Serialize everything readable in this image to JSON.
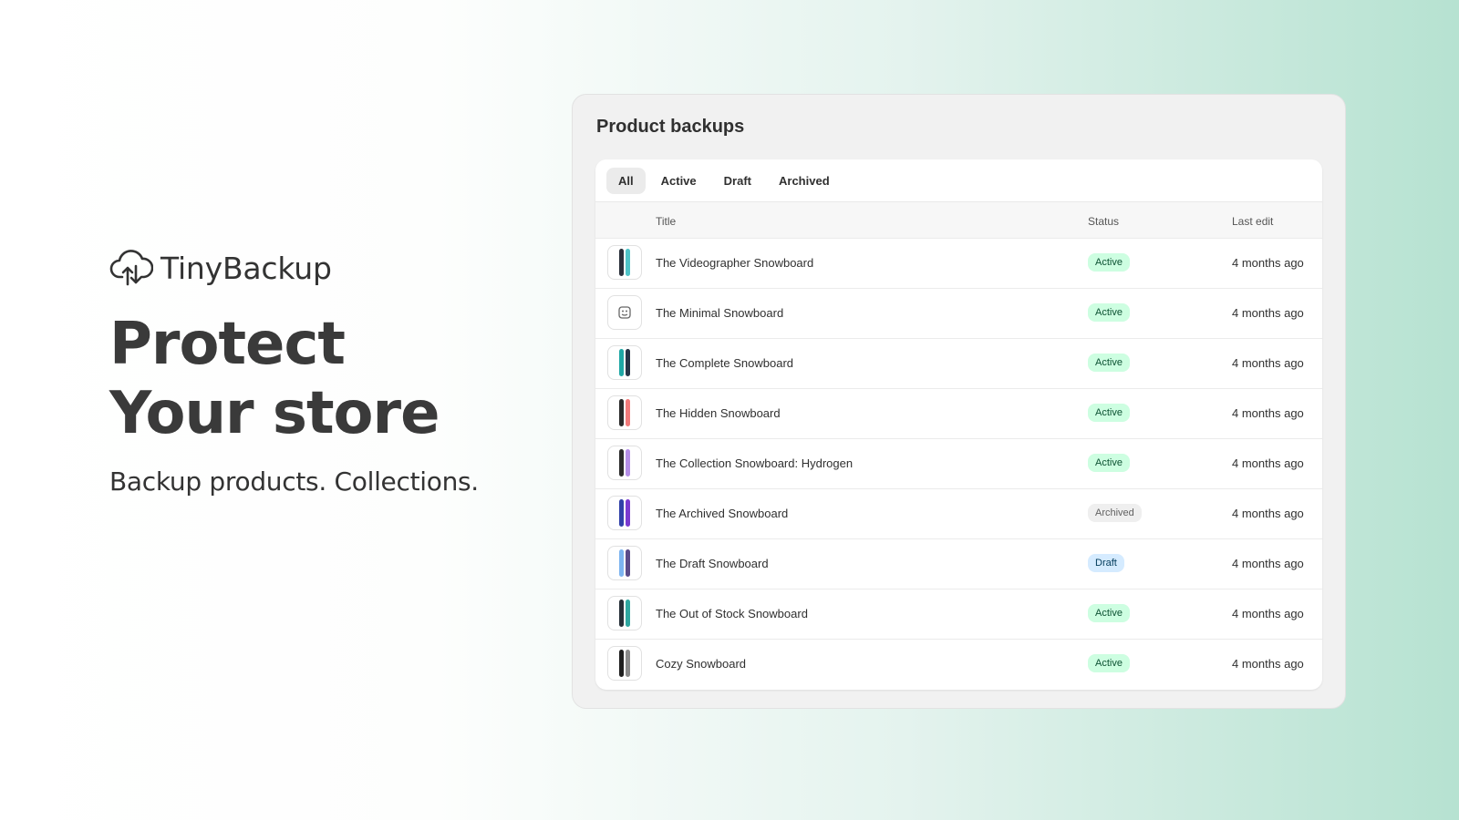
{
  "brand": {
    "name": "TinyBackup",
    "logo_icon": "cloud-upload-download-icon"
  },
  "hero": {
    "headline_line1": "Protect",
    "headline_line2": "Your store",
    "subline": "Backup products. Collections."
  },
  "panel": {
    "title": "Product backups",
    "tabs": [
      {
        "label": "All",
        "selected": true
      },
      {
        "label": "Active",
        "selected": false
      },
      {
        "label": "Draft",
        "selected": false
      },
      {
        "label": "Archived",
        "selected": false
      }
    ],
    "columns": {
      "title": "Title",
      "status": "Status",
      "last_edit": "Last edit"
    },
    "rows": [
      {
        "title": "The Videographer Snowboard",
        "status": "Active",
        "last_edit": "4 months ago",
        "thumb_colors": [
          "#2a2f3a",
          "#4fc3c7"
        ]
      },
      {
        "title": "The Minimal Snowboard",
        "status": "Active",
        "last_edit": "4 months ago",
        "thumb_icon": "image-placeholder-icon"
      },
      {
        "title": "The Complete Snowboard",
        "status": "Active",
        "last_edit": "4 months ago",
        "thumb_colors": [
          "#1fa7a5",
          "#263447"
        ]
      },
      {
        "title": "The Hidden Snowboard",
        "status": "Active",
        "last_edit": "4 months ago",
        "thumb_colors": [
          "#2a2a2a",
          "#f07a7a"
        ]
      },
      {
        "title": "The Collection Snowboard: Hydrogen",
        "status": "Active",
        "last_edit": "4 months ago",
        "thumb_colors": [
          "#2b2b2b",
          "#b48ee6"
        ]
      },
      {
        "title": "The Archived Snowboard",
        "status": "Archived",
        "last_edit": "4 months ago",
        "thumb_colors": [
          "#3040a8",
          "#7a3ad0"
        ]
      },
      {
        "title": "The Draft Snowboard",
        "status": "Draft",
        "last_edit": "4 months ago",
        "thumb_colors": [
          "#7db4f0",
          "#5b4b8a"
        ]
      },
      {
        "title": "The Out of Stock Snowboard",
        "status": "Active",
        "last_edit": "4 months ago",
        "thumb_colors": [
          "#263038",
          "#2fa7a0"
        ]
      },
      {
        "title": "Cozy Snowboard",
        "status": "Active",
        "last_edit": "4 months ago",
        "thumb_colors": [
          "#1f1f1f",
          "#8a8a8a"
        ]
      }
    ]
  },
  "colors": {
    "badge_active_bg": "#cdfee1",
    "badge_active_text": "#0c5132",
    "badge_draft_bg": "#d5ebff",
    "badge_draft_text": "#003a5a",
    "badge_archived_bg": "#efefef",
    "badge_archived_text": "#616161"
  }
}
